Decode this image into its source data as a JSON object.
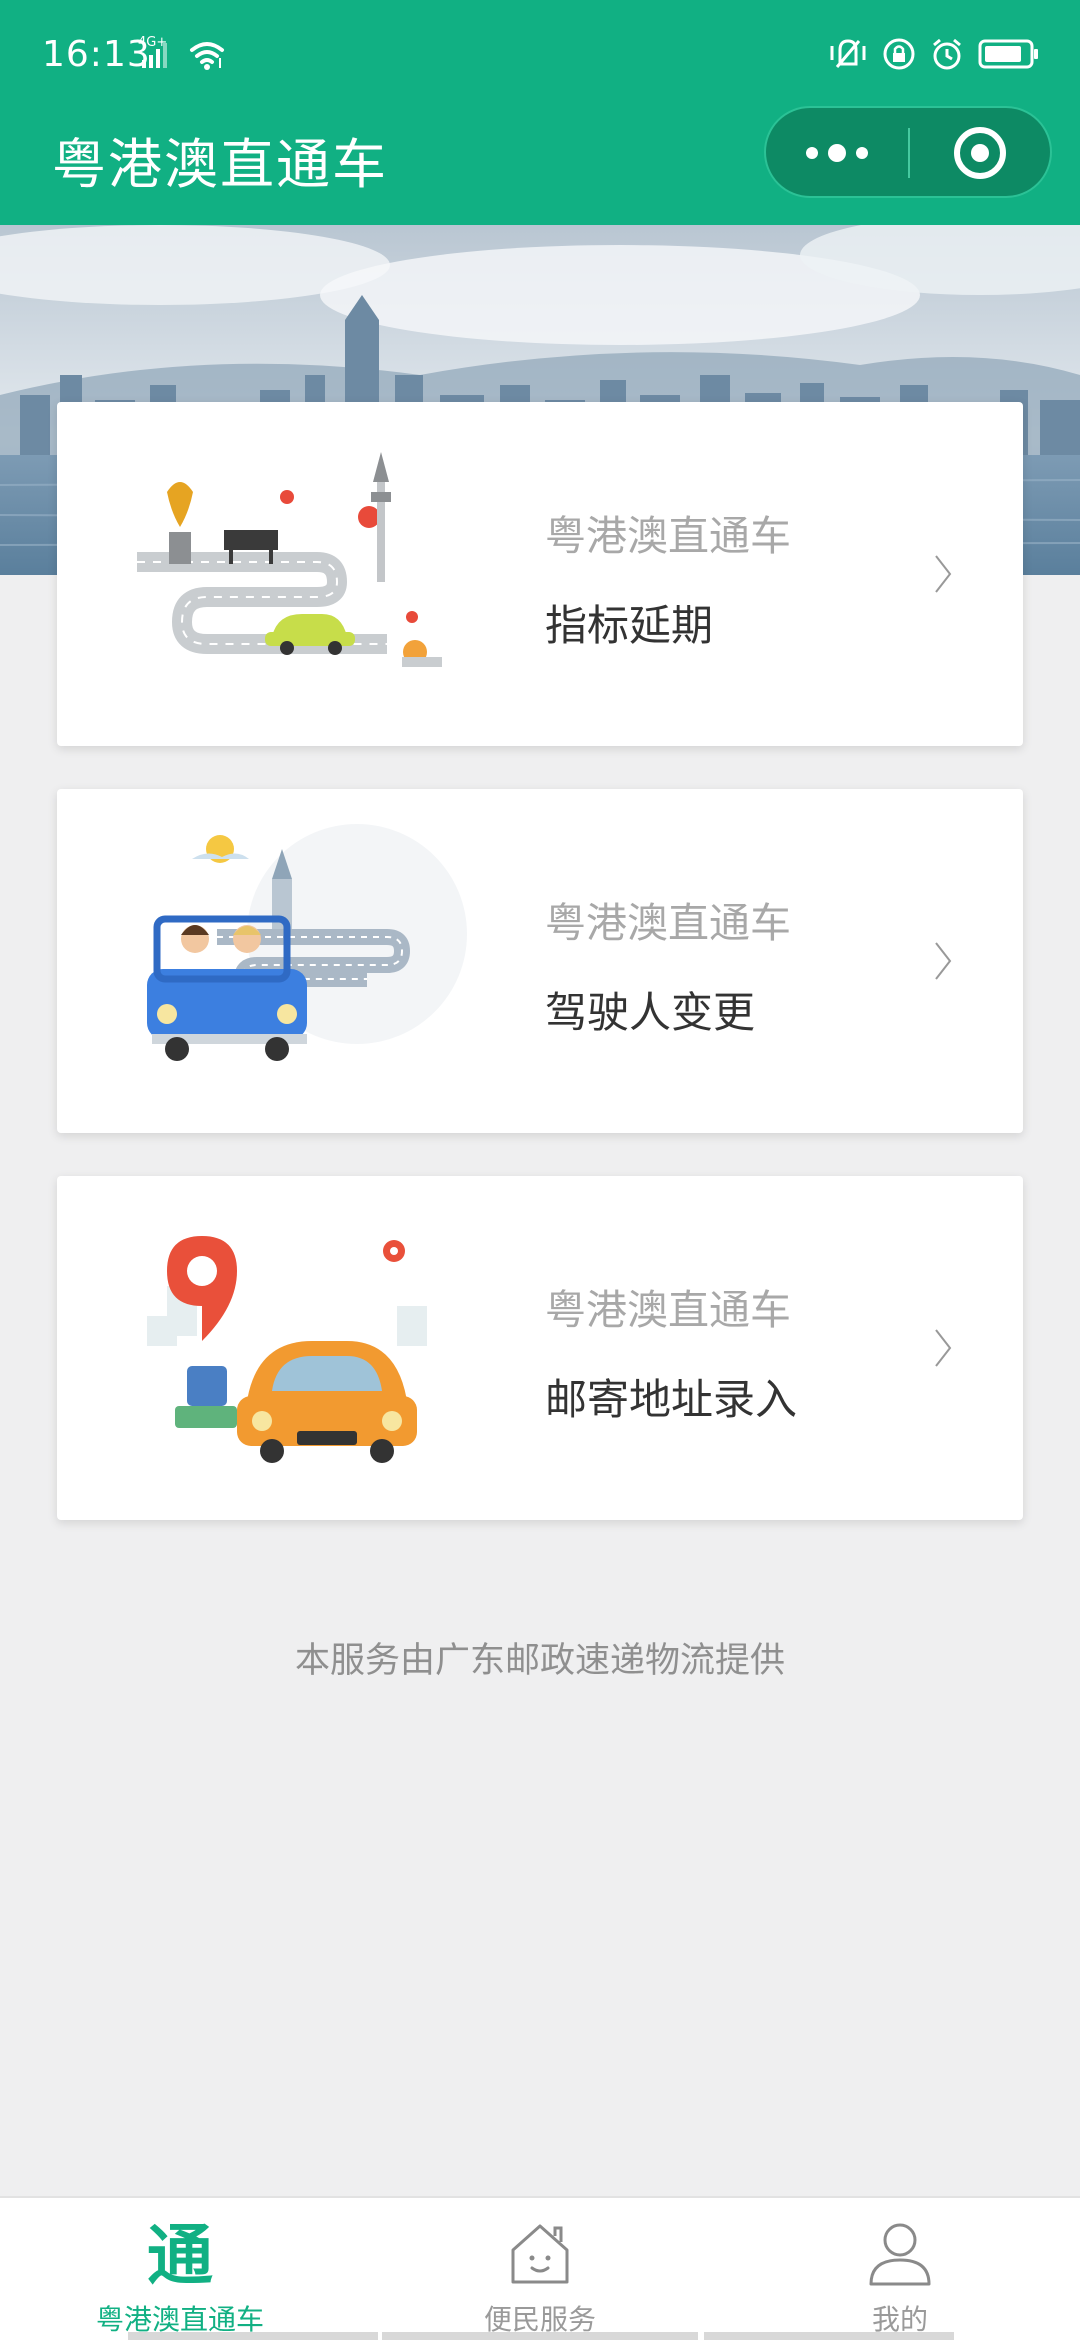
{
  "status_bar": {
    "time": "16:13",
    "network": "4G+"
  },
  "header": {
    "title": "粤港澳直通车"
  },
  "cards": [
    {
      "subtitle": "粤港澳直通车",
      "title": "指标延期",
      "illustration": "hong-kong-road-car-illustration"
    },
    {
      "subtitle": "粤港澳直通车",
      "title": "驾驶人变更",
      "illustration": "drivers-in-blue-car-illustration"
    },
    {
      "subtitle": "粤港澳直通车",
      "title": "邮寄地址录入",
      "illustration": "location-pin-orange-car-illustration"
    }
  ],
  "footer_note": "本服务由广东邮政速递物流提供",
  "tabbar": {
    "items": [
      {
        "label": "粤港澳直通车",
        "icon": "tong-icon",
        "active": true
      },
      {
        "label": "便民服务",
        "icon": "house-icon",
        "active": false
      },
      {
        "label": "我的",
        "icon": "person-icon",
        "active": false
      }
    ],
    "tong_glyph": "通"
  },
  "colors": {
    "brand": "#11b083",
    "capsule": "#0d8a64",
    "background": "#efeff0"
  }
}
